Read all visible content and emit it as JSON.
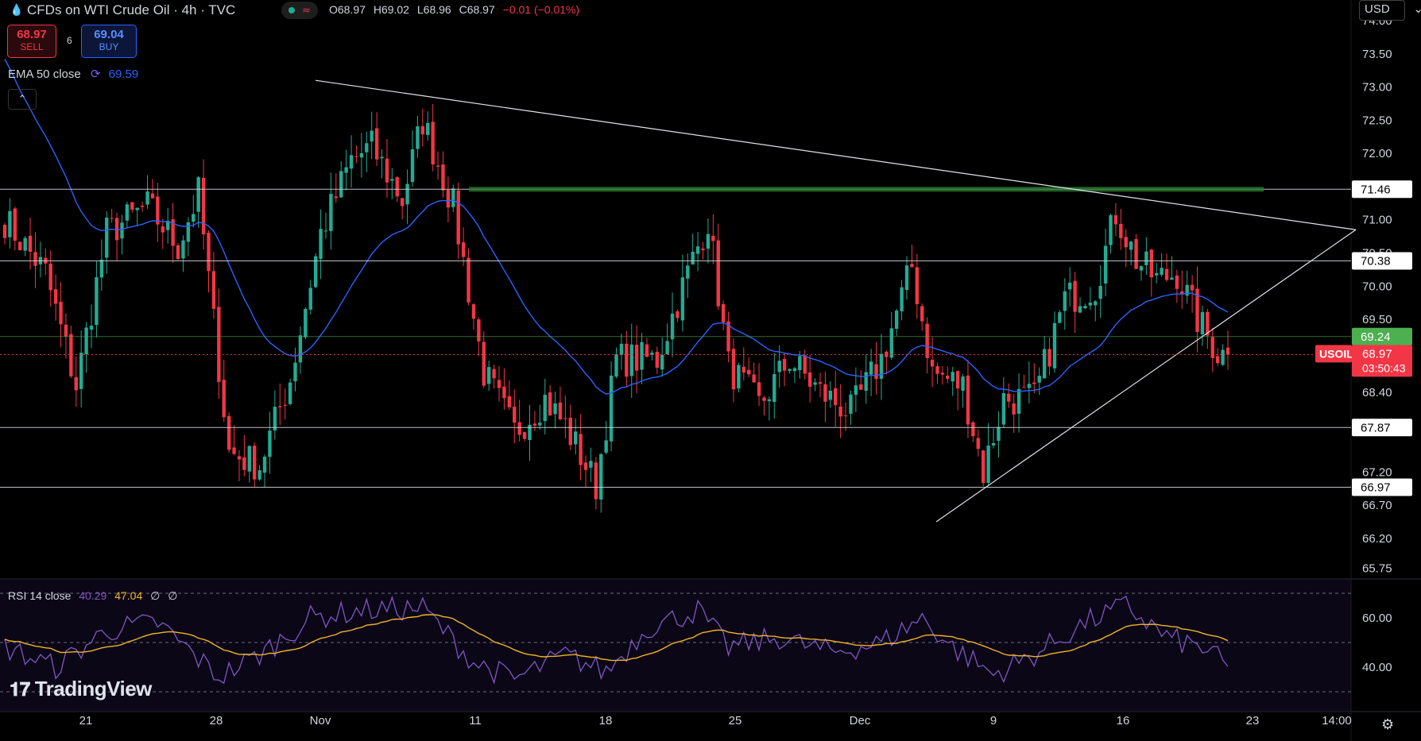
{
  "header": {
    "symbol": "CFDs on WTI Crude Oil · 4h · TVC",
    "ohlc": {
      "o": "O68.97",
      "h": "H69.02",
      "l": "L68.96",
      "c": "C68.97",
      "chg": "−0.01 (−0.01%)"
    }
  },
  "trade": {
    "sell_price": "68.97",
    "sell_label": "SELL",
    "buy_price": "69.04",
    "buy_label": "BUY",
    "spread": "6"
  },
  "ema": {
    "label": "EMA 50 close",
    "value": "69.59"
  },
  "rsi": {
    "label": "RSI 14 close",
    "value": "40.29",
    "ma": "47.04",
    "x1": "∅",
    "x2": "∅"
  },
  "brand": "TradingView",
  "currency": "USD",
  "price_axis": {
    "ticks": [
      "73.50",
      "73.00",
      "72.50",
      "72.00",
      "71.00",
      "70.50",
      "70.00",
      "69.50",
      "68.40",
      "67.20",
      "66.70",
      "66.20",
      "65.75"
    ],
    "top_partial": "74.00"
  },
  "levels": [
    {
      "value": 71.46,
      "label": "71.46"
    },
    {
      "value": 70.38,
      "label": "70.38"
    },
    {
      "value": 69.24,
      "label": "69.24"
    },
    {
      "value": 67.87,
      "label": "67.87"
    },
    {
      "value": 66.97,
      "label": "66.97"
    }
  ],
  "current": {
    "symbol": "USOIL",
    "price": "68.97",
    "timer": "03:50:43"
  },
  "rsi_axis": {
    "ticks": [
      "60.00",
      "40.00"
    ]
  },
  "time_axis": [
    "21",
    "28",
    "Nov",
    "11",
    "18",
    "25",
    "Dec",
    "9",
    "16",
    "23",
    "14:00"
  ],
  "colors": {
    "up": "#22ab94",
    "down": "#f23645",
    "ema": "#2962ff",
    "rsi": "#7e57c2",
    "rsi_ma": "#f0b429"
  },
  "chart_data": {
    "type": "candlestick",
    "timeframe": "4h",
    "ylim": [
      65.6,
      74.0
    ],
    "overlays": [
      "EMA 50",
      "resistance 71.46",
      "trendline descending",
      "trendline ascending"
    ],
    "anchors": [
      {
        "x": 0,
        "close": 71.0
      },
      {
        "x": 8,
        "close": 70.2
      },
      {
        "x": 14,
        "close": 68.5
      },
      {
        "x": 20,
        "close": 70.8
      },
      {
        "x": 28,
        "close": 71.2
      },
      {
        "x": 34,
        "close": 70.6
      },
      {
        "x": 38,
        "close": 71.4
      },
      {
        "x": 44,
        "close": 67.5
      },
      {
        "x": 50,
        "close": 67.3
      },
      {
        "x": 56,
        "close": 68.6
      },
      {
        "x": 62,
        "close": 70.8
      },
      {
        "x": 68,
        "close": 71.9
      },
      {
        "x": 72,
        "close": 72.1
      },
      {
        "x": 78,
        "close": 71.3
      },
      {
        "x": 82,
        "close": 72.5
      },
      {
        "x": 88,
        "close": 71.2
      },
      {
        "x": 94,
        "close": 68.7
      },
      {
        "x": 100,
        "close": 67.8
      },
      {
        "x": 106,
        "close": 68.3
      },
      {
        "x": 110,
        "close": 67.9
      },
      {
        "x": 116,
        "close": 67.0
      },
      {
        "x": 120,
        "close": 68.9
      },
      {
        "x": 128,
        "close": 68.9
      },
      {
        "x": 134,
        "close": 70.2
      },
      {
        "x": 138,
        "close": 71.0
      },
      {
        "x": 142,
        "close": 68.8
      },
      {
        "x": 148,
        "close": 68.2
      },
      {
        "x": 154,
        "close": 68.9
      },
      {
        "x": 160,
        "close": 68.4
      },
      {
        "x": 166,
        "close": 68.1
      },
      {
        "x": 172,
        "close": 68.9
      },
      {
        "x": 178,
        "close": 70.3
      },
      {
        "x": 182,
        "close": 68.7
      },
      {
        "x": 188,
        "close": 68.5
      },
      {
        "x": 192,
        "close": 67.2
      },
      {
        "x": 196,
        "close": 68.3
      },
      {
        "x": 202,
        "close": 68.3
      },
      {
        "x": 208,
        "close": 69.8
      },
      {
        "x": 214,
        "close": 70.0
      },
      {
        "x": 218,
        "close": 71.1
      },
      {
        "x": 222,
        "close": 70.4
      },
      {
        "x": 226,
        "close": 70.1
      },
      {
        "x": 230,
        "close": 70.2
      },
      {
        "x": 234,
        "close": 69.5
      },
      {
        "x": 238,
        "close": 69.0
      },
      {
        "x": 240,
        "close": 68.97
      }
    ],
    "rsi_anchors": [
      {
        "x": 0,
        "v": 48
      },
      {
        "x": 10,
        "v": 40
      },
      {
        "x": 20,
        "v": 55
      },
      {
        "x": 30,
        "v": 58
      },
      {
        "x": 42,
        "v": 36
      },
      {
        "x": 50,
        "v": 45
      },
      {
        "x": 60,
        "v": 60
      },
      {
        "x": 70,
        "v": 63
      },
      {
        "x": 82,
        "v": 64
      },
      {
        "x": 92,
        "v": 42
      },
      {
        "x": 100,
        "v": 35
      },
      {
        "x": 110,
        "v": 45
      },
      {
        "x": 118,
        "v": 38
      },
      {
        "x": 126,
        "v": 56
      },
      {
        "x": 136,
        "v": 63
      },
      {
        "x": 142,
        "v": 48
      },
      {
        "x": 152,
        "v": 52
      },
      {
        "x": 162,
        "v": 46
      },
      {
        "x": 172,
        "v": 50
      },
      {
        "x": 180,
        "v": 60
      },
      {
        "x": 186,
        "v": 48
      },
      {
        "x": 194,
        "v": 37
      },
      {
        "x": 202,
        "v": 45
      },
      {
        "x": 212,
        "v": 58
      },
      {
        "x": 220,
        "v": 65
      },
      {
        "x": 228,
        "v": 52
      },
      {
        "x": 236,
        "v": 47
      },
      {
        "x": 240,
        "v": 40
      }
    ]
  }
}
